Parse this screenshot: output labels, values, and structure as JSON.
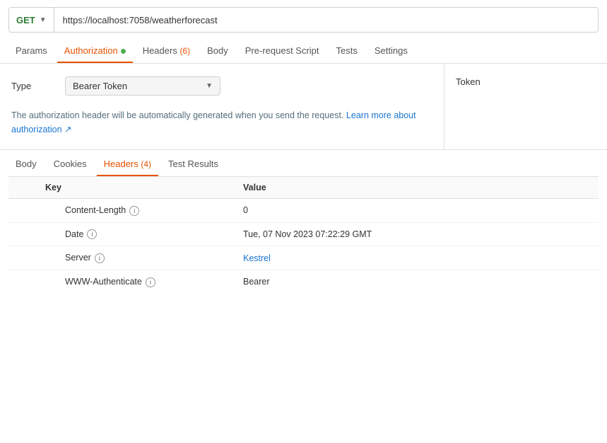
{
  "urlBar": {
    "method": "GET",
    "url": "https://localhost:7058/weatherforecast"
  },
  "tabsTop": [
    {
      "id": "params",
      "label": "Params",
      "active": false,
      "dot": false,
      "badge": null
    },
    {
      "id": "authorization",
      "label": "Authorization",
      "active": true,
      "dot": true,
      "badge": null
    },
    {
      "id": "headers",
      "label": "Headers",
      "active": false,
      "dot": false,
      "badge": "(6)"
    },
    {
      "id": "body",
      "label": "Body",
      "active": false,
      "dot": false,
      "badge": null
    },
    {
      "id": "prerequest",
      "label": "Pre-request Script",
      "active": false,
      "dot": false,
      "badge": null
    },
    {
      "id": "tests",
      "label": "Tests",
      "active": false,
      "dot": false,
      "badge": null
    },
    {
      "id": "settings",
      "label": "Settings",
      "active": false,
      "dot": false,
      "badge": null
    }
  ],
  "authPanel": {
    "typeLabel": "Type",
    "bearerToken": "Bearer Token",
    "infoText": "The authorization header will be automatically generated when you send the request.",
    "linkText": "Learn more about authorization ↗",
    "tokenLabel": "Token"
  },
  "tabsBottom": [
    {
      "id": "body",
      "label": "Body",
      "active": false,
      "badge": null
    },
    {
      "id": "cookies",
      "label": "Cookies",
      "active": false,
      "badge": null
    },
    {
      "id": "headers",
      "label": "Headers",
      "active": true,
      "badge": "(4)"
    },
    {
      "id": "testresults",
      "label": "Test Results",
      "active": false,
      "badge": null
    }
  ],
  "responseTable": {
    "columns": [
      "Key",
      "Value"
    ],
    "rows": [
      {
        "key": "Content-Length",
        "hasInfo": true,
        "value": "0",
        "valueBlue": false
      },
      {
        "key": "Date",
        "hasInfo": true,
        "value": "Tue, 07 Nov 2023 07:22:29 GMT",
        "valueBlue": false
      },
      {
        "key": "Server",
        "hasInfo": true,
        "value": "Kestrel",
        "valueBlue": true
      },
      {
        "key": "WWW-Authenticate",
        "hasInfo": true,
        "value": "Bearer",
        "valueBlue": false
      }
    ]
  }
}
